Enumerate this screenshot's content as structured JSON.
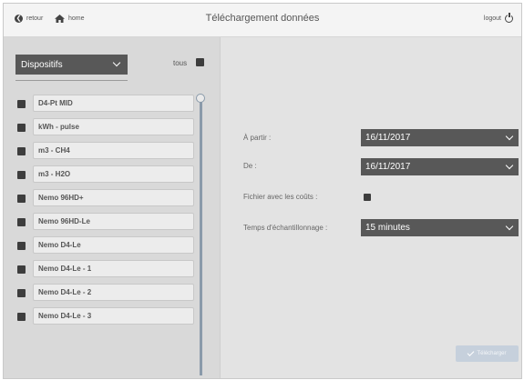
{
  "header": {
    "back_label": "retour",
    "home_label": "home",
    "title": "Téléchargement données",
    "logout_label": "logout"
  },
  "left": {
    "device_select": "Dispositifs",
    "tous_label": "tous",
    "devices": [
      "D4-Pt MID",
      "kWh - pulse",
      "m3 - CH4",
      "m3 - H2O",
      "Nemo 96HD+",
      "Nemo 96HD-Le",
      "Nemo D4-Le",
      "Nemo D4-Le - 1",
      "Nemo D4-Le - 2",
      "Nemo D4-Le - 3"
    ]
  },
  "form": {
    "from_label": "À partir :",
    "from_value": "16/11/2017",
    "to_label": "De :",
    "to_value": "16/11/2017",
    "costs_label": "Fichier avec les coûts :",
    "sampling_label": "Temps d'échantillonnage :",
    "sampling_value": "15 minutes"
  },
  "download_label": "Télécharger",
  "icons": {
    "back": "back-arrow-icon",
    "home": "home-icon",
    "logout": "power-icon"
  }
}
